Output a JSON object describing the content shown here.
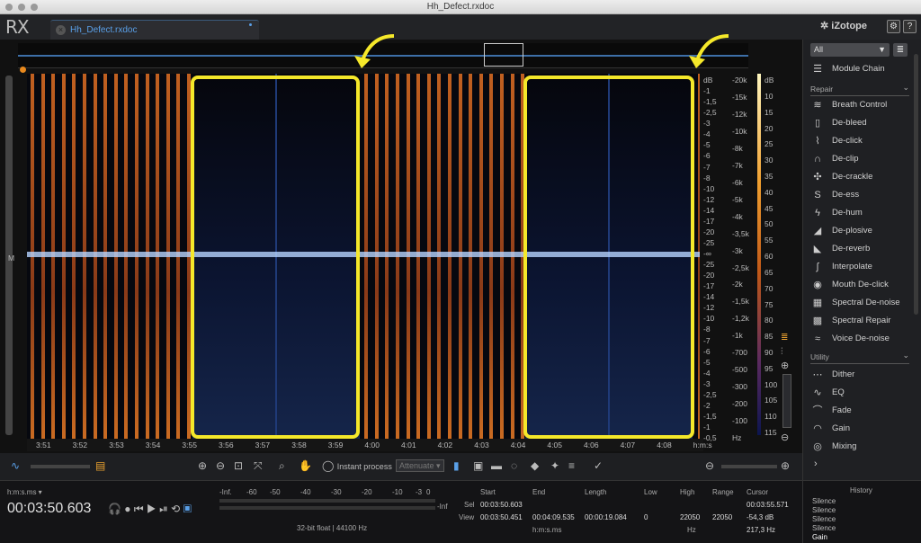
{
  "window": {
    "title": "Hh_Defect.rxdoc"
  },
  "app": {
    "logo": "RX",
    "brand": "iZotope",
    "settings_icon": "gear-icon",
    "help": "?"
  },
  "tab": {
    "name": "Hh_Defect.rxdoc"
  },
  "overview": {
    "left_label": "M"
  },
  "db_scale": [
    "dB",
    "-1",
    "-1,5",
    "-2,5",
    "-3",
    "-4",
    "-5",
    "-6",
    "-7",
    "-8",
    "-10",
    "-12",
    "-14",
    "-17",
    "-20",
    "-25",
    "-∞",
    "-25",
    "-20",
    "-17",
    "-14",
    "-12",
    "-10",
    "-8",
    "-7",
    "-6",
    "-5",
    "-4",
    "-3",
    "-2,5",
    "-2",
    "-1,5",
    "-1",
    "-0,5"
  ],
  "hz_scale": [
    "-20k",
    "-15k",
    "-12k",
    "-10k",
    "-8k",
    "-7k",
    "-6k",
    "-5k",
    "-4k",
    "-3,5k",
    "-3k",
    "-2,5k",
    "-2k",
    "-1,5k",
    "-1,2k",
    "-1k",
    "-700",
    "-500",
    "-300",
    "-200",
    "-100",
    "Hz"
  ],
  "cb_scale": [
    "dB",
    "10",
    "15",
    "20",
    "25",
    "30",
    "35",
    "40",
    "45",
    "50",
    "55",
    "60",
    "65",
    "70",
    "75",
    "80",
    "85",
    "90",
    "95",
    "100",
    "105",
    "110",
    "115"
  ],
  "time_axis": [
    "3:51",
    "3:52",
    "3:53",
    "3:54",
    "3:55",
    "3:56",
    "3:57",
    "3:58",
    "3:59",
    "4:00",
    "4:01",
    "4:02",
    "4:03",
    "4:04",
    "4:05",
    "4:06",
    "4:07",
    "4:08",
    "h:m:s"
  ],
  "toolbar": {
    "instant_process": "Instant process",
    "attenuate": "Attenuate"
  },
  "status": {
    "time_format": "h:m:s.ms",
    "position": "00:03:50.603",
    "meter_ticks": [
      "-Inf.",
      "-60",
      "-50",
      "-40",
      "-30",
      "-20",
      "-10",
      "-3",
      "0"
    ],
    "meter_inf": "-Inf",
    "format": "32-bit float | 44100 Hz",
    "headers": {
      "start": "Start",
      "end": "End",
      "length": "Length",
      "low": "Low",
      "high": "High",
      "range": "Range",
      "cursor": "Cursor"
    },
    "sel": {
      "label": "Sel",
      "start": "00:03:50.603"
    },
    "view": {
      "label": "View",
      "start": "00:03:50.451",
      "end": "00:04:09.535",
      "length": "00:00:19.084",
      "low": "0",
      "high": "22050",
      "range": "22050"
    },
    "units_time": "h:m:s.ms",
    "units_hz": "Hz",
    "cursor": {
      "time": "00:03:55.571",
      "db": "-54,3 dB",
      "hz": "217,3 Hz"
    }
  },
  "sidebar": {
    "filter": "All",
    "module_chain": "Module Chain",
    "repair_label": "Repair",
    "repair": [
      {
        "label": "Breath Control",
        "icon": "breath-icon"
      },
      {
        "label": "De-bleed",
        "icon": "debleed-icon"
      },
      {
        "label": "De-click",
        "icon": "declick-icon"
      },
      {
        "label": "De-clip",
        "icon": "declip-icon"
      },
      {
        "label": "De-crackle",
        "icon": "decrackle-icon"
      },
      {
        "label": "De-ess",
        "icon": "deess-icon"
      },
      {
        "label": "De-hum",
        "icon": "dehum-icon"
      },
      {
        "label": "De-plosive",
        "icon": "deplosive-icon"
      },
      {
        "label": "De-reverb",
        "icon": "dereverb-icon"
      },
      {
        "label": "Interpolate",
        "icon": "interpolate-icon"
      },
      {
        "label": "Mouth De-click",
        "icon": "mouth-icon"
      },
      {
        "label": "Spectral De-noise",
        "icon": "spectral-denoise-icon"
      },
      {
        "label": "Spectral Repair",
        "icon": "spectral-repair-icon"
      },
      {
        "label": "Voice De-noise",
        "icon": "voice-denoise-icon"
      }
    ],
    "utility_label": "Utility",
    "utility": [
      {
        "label": "Dither",
        "icon": "dither-icon"
      },
      {
        "label": "EQ",
        "icon": "eq-icon"
      },
      {
        "label": "Fade",
        "icon": "fade-icon"
      },
      {
        "label": "Gain",
        "icon": "gain-icon"
      },
      {
        "label": "Mixing",
        "icon": "mixing-icon"
      }
    ]
  },
  "history": {
    "title": "History",
    "items": [
      "Silence",
      "Silence",
      "Silence",
      "Silence",
      "Gain"
    ]
  },
  "colors": {
    "accent": "#5aa0e8",
    "highlight": "#f5e82a",
    "spectrum_hot": "#c86a22"
  }
}
